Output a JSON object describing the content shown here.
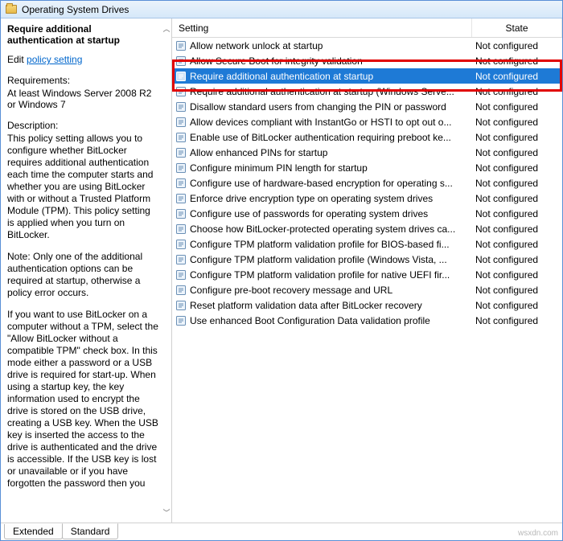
{
  "window": {
    "title": "Operating System Drives"
  },
  "left": {
    "policy_title": "Require additional authentication at startup",
    "edit_prefix": "Edit ",
    "edit_link": "policy setting",
    "requirements_label": "Requirements:",
    "requirements_body": "At least Windows Server 2008 R2 or Windows 7",
    "description_label": "Description:",
    "description_paragraphs": [
      "This policy setting allows you to configure whether BitLocker requires additional authentication each time the computer starts and whether you are using BitLocker with or without a Trusted Platform Module (TPM). This policy setting is applied when you turn on BitLocker.",
      "Note: Only one of the additional authentication options can be required at startup, otherwise a policy error occurs.",
      "If you want to use BitLocker on a computer without a TPM, select the \"Allow BitLocker without a compatible TPM\" check box. In this mode either a password or a USB drive is required for start-up. When using a startup key, the key information used to encrypt the drive is stored on the USB drive, creating a USB key. When the USB key is inserted the access to the drive is authenticated and the drive is accessible. If the USB key is lost or unavailable or if you have forgotten the password then you"
    ]
  },
  "columns": {
    "setting": "Setting",
    "state": "State"
  },
  "rows": [
    {
      "label": "Allow network unlock at startup",
      "state": "Not configured"
    },
    {
      "label": "Allow Secure Boot for integrity validation",
      "state": "Not configured"
    },
    {
      "label": "Require additional authentication at startup",
      "state": "Not configured",
      "selected": true,
      "highlighted": true
    },
    {
      "label": "Require additional authentication at startup (Windows Serve...",
      "state": "Not configured"
    },
    {
      "label": "Disallow standard users from changing the PIN or password",
      "state": "Not configured"
    },
    {
      "label": "Allow devices compliant with InstantGo or HSTI to opt out o...",
      "state": "Not configured"
    },
    {
      "label": "Enable use of BitLocker authentication requiring preboot ke...",
      "state": "Not configured"
    },
    {
      "label": "Allow enhanced PINs for startup",
      "state": "Not configured"
    },
    {
      "label": "Configure minimum PIN length for startup",
      "state": "Not configured"
    },
    {
      "label": "Configure use of hardware-based encryption for operating s...",
      "state": "Not configured"
    },
    {
      "label": "Enforce drive encryption type on operating system drives",
      "state": "Not configured"
    },
    {
      "label": "Configure use of passwords for operating system drives",
      "state": "Not configured"
    },
    {
      "label": "Choose how BitLocker-protected operating system drives ca...",
      "state": "Not configured"
    },
    {
      "label": "Configure TPM platform validation profile for BIOS-based fi...",
      "state": "Not configured"
    },
    {
      "label": "Configure TPM platform validation profile (Windows Vista, ...",
      "state": "Not configured"
    },
    {
      "label": "Configure TPM platform validation profile for native UEFI fir...",
      "state": "Not configured"
    },
    {
      "label": "Configure pre-boot recovery message and URL",
      "state": "Not configured"
    },
    {
      "label": "Reset platform validation data after BitLocker recovery",
      "state": "Not configured"
    },
    {
      "label": "Use enhanced Boot Configuration Data validation profile",
      "state": "Not configured"
    }
  ],
  "tabs": {
    "extended": "Extended",
    "standard": "Standard"
  },
  "credit": "wsxdn.com"
}
